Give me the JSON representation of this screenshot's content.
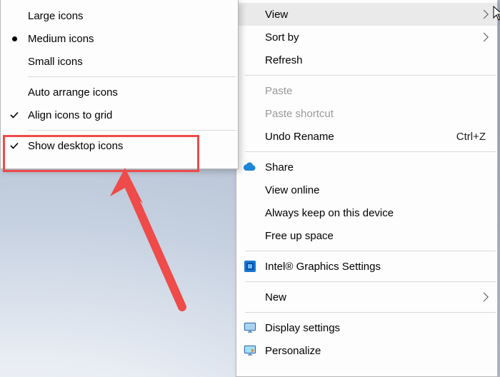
{
  "primary": {
    "items": [
      {
        "label": "Large icons"
      },
      {
        "label": "Medium icons"
      },
      {
        "label": "Small icons"
      },
      {
        "label": "Auto arrange icons"
      },
      {
        "label": "Align icons to grid"
      },
      {
        "label": "Show desktop icons"
      }
    ]
  },
  "secondary": {
    "items": [
      {
        "label": "View"
      },
      {
        "label": "Sort by"
      },
      {
        "label": "Refresh"
      },
      {
        "label": "Paste"
      },
      {
        "label": "Paste shortcut"
      },
      {
        "label": "Undo Rename",
        "shortcut": "Ctrl+Z"
      },
      {
        "label": "Share"
      },
      {
        "label": "View online"
      },
      {
        "label": "Always keep on this device"
      },
      {
        "label": "Free up space"
      },
      {
        "label": "Intel® Graphics Settings"
      },
      {
        "label": "New"
      },
      {
        "label": "Display settings"
      },
      {
        "label": "Personalize"
      }
    ]
  }
}
